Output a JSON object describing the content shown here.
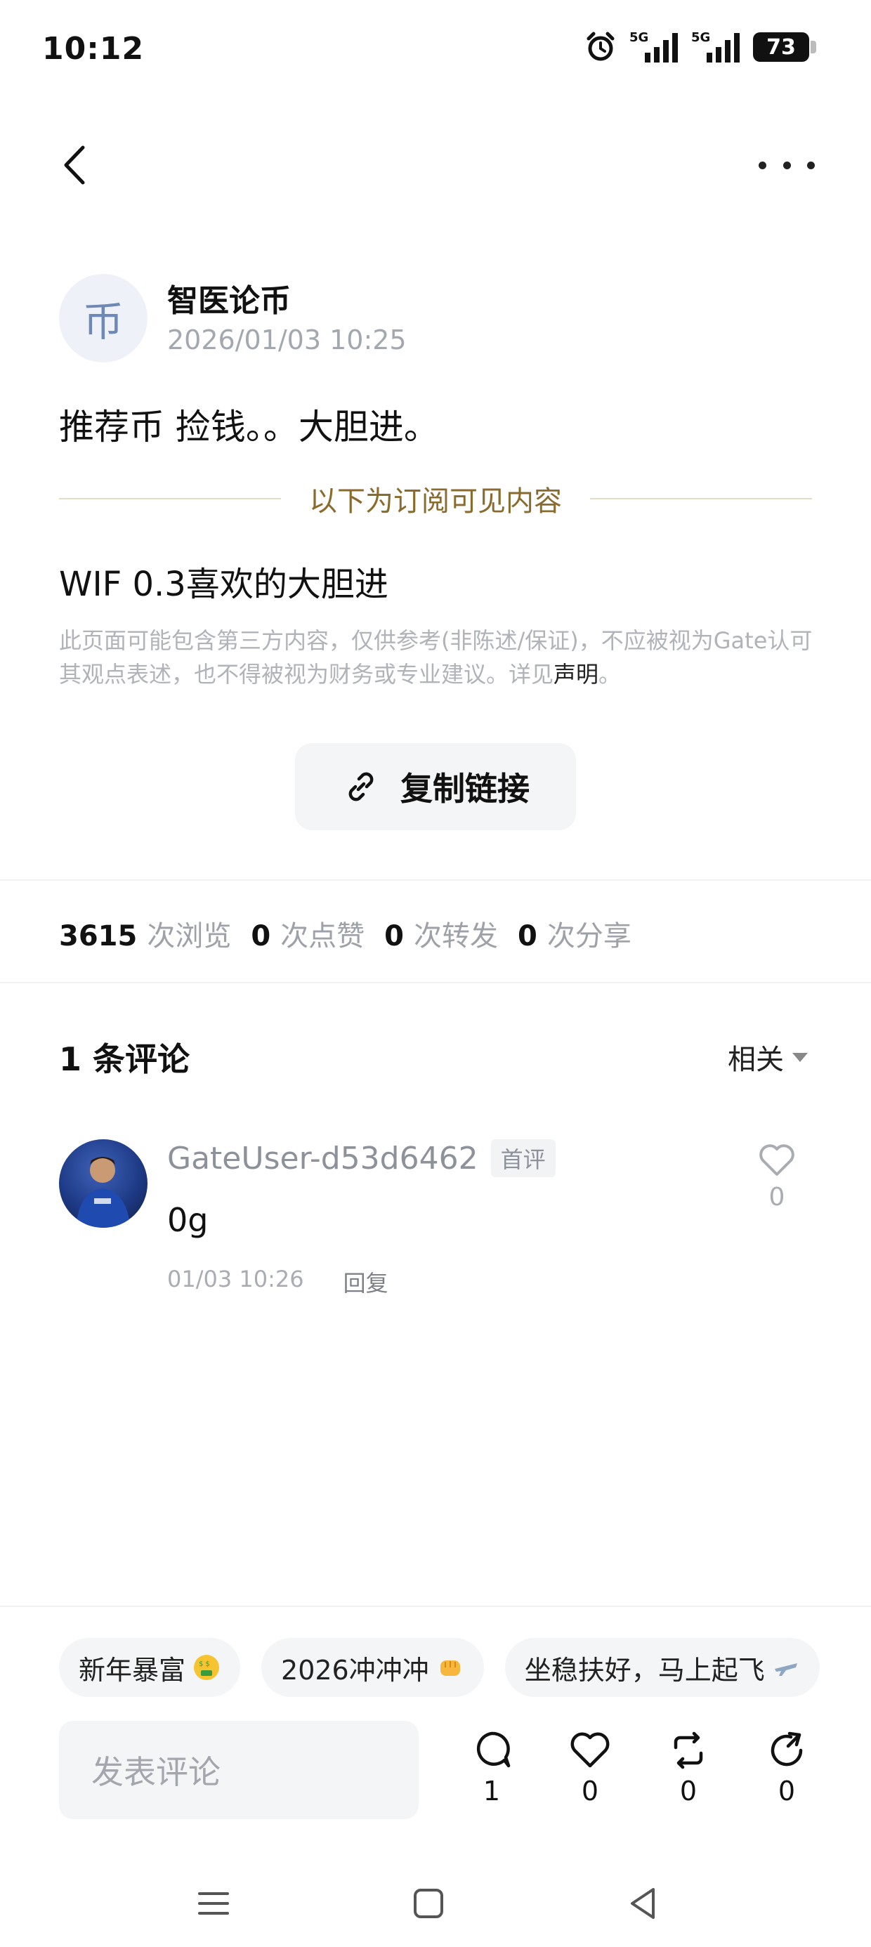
{
  "status_bar": {
    "time": "10:12",
    "signal1_label": "5G",
    "signal2_label": "5G",
    "battery": "73"
  },
  "author": {
    "avatar_text": "币",
    "name": "智医论币",
    "time": "2026/01/03 10:25"
  },
  "post": {
    "text": "推荐币 捡钱。。大胆进。",
    "divider_label": "以下为订阅可见内容",
    "subscriber_text": "WIF 0.3喜欢的大胆进",
    "disclaimer": "此页面可能包含第三方内容，仅供参考(非陈述/保证)，不应被视为Gate认可其观点表述，也不得被视为财务或专业建议。详见",
    "disclaimer_link": "声明",
    "disclaimer_end": "。",
    "copy_link_label": "复制链接"
  },
  "stats": [
    {
      "num": "3615",
      "label": "次浏览"
    },
    {
      "num": "0",
      "label": "次点赞"
    },
    {
      "num": "0",
      "label": "次转发"
    },
    {
      "num": "0",
      "label": "次分享"
    }
  ],
  "comments": {
    "title": "1 条评论",
    "sort_label": "相关",
    "items": [
      {
        "user": "GateUser-d53d6462",
        "badge": "首评",
        "text": "0g",
        "time": "01/03 10:26",
        "reply_label": "回复",
        "likes": "0"
      }
    ]
  },
  "tags": [
    {
      "label": "新年暴富",
      "emoji": "money-mouth-face"
    },
    {
      "label": "2026冲冲冲",
      "emoji": "fist"
    },
    {
      "label": "坐稳扶好，马上起飞",
      "emoji": "airplane"
    }
  ],
  "bottom_bar": {
    "input_placeholder": "发表评论",
    "comment_count": "1",
    "like_count": "0",
    "repost_count": "0",
    "share_count": "0"
  },
  "colors": {
    "accent_gold": "#8a6b2e",
    "muted_text": "#a3a8b0",
    "chip_bg": "#f4f5f7"
  }
}
